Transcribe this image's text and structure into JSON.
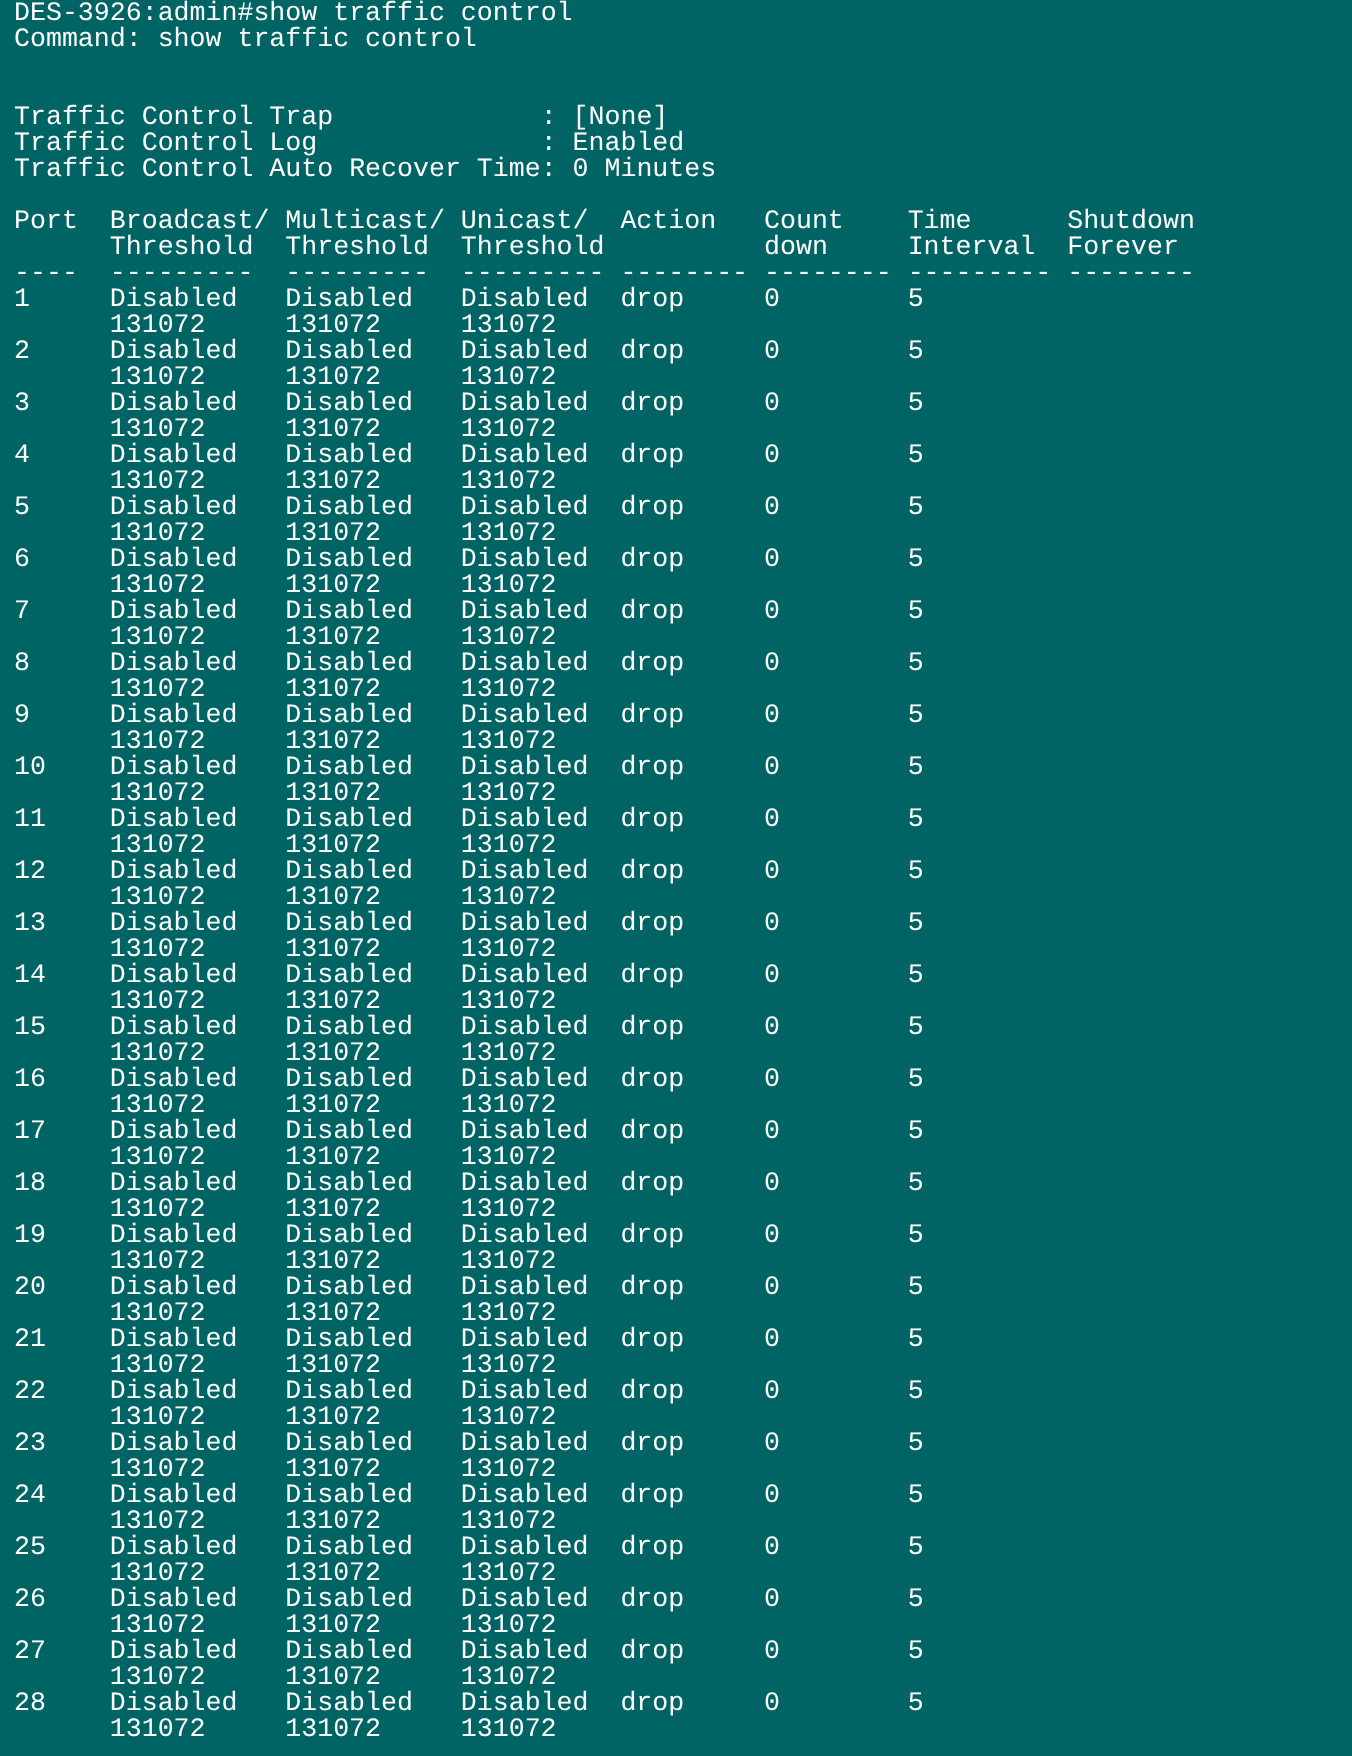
{
  "command_lines": [
    "DES-3926:admin#show traffic control",
    "Command: show traffic control"
  ],
  "settings": [
    "Traffic Control Trap             : [None]",
    "Traffic Control Log              : Enabled",
    "Traffic Control Auto Recover Time: 0 Minutes"
  ],
  "table": {
    "columns": [
      "Port",
      "Broadcast/ Threshold",
      "Multicast/ Threshold",
      "Unicast/ Threshold",
      "Action",
      "Count down",
      "Time Interval",
      "Shutdown Forever"
    ],
    "separators": [
      "----",
      "---------",
      "---------",
      "---------",
      "--------",
      "--------",
      "---------",
      "--------"
    ],
    "rows": [
      {
        "port": "1",
        "broadcast": "Disabled",
        "broadcast_threshold": "131072",
        "multicast": "Disabled",
        "multicast_threshold": "131072",
        "unicast": "Disabled",
        "unicast_threshold": "131072",
        "action": "drop",
        "countdown": "0",
        "interval": "5"
      },
      {
        "port": "2",
        "broadcast": "Disabled",
        "broadcast_threshold": "131072",
        "multicast": "Disabled",
        "multicast_threshold": "131072",
        "unicast": "Disabled",
        "unicast_threshold": "131072",
        "action": "drop",
        "countdown": "0",
        "interval": "5"
      },
      {
        "port": "3",
        "broadcast": "Disabled",
        "broadcast_threshold": "131072",
        "multicast": "Disabled",
        "multicast_threshold": "131072",
        "unicast": "Disabled",
        "unicast_threshold": "131072",
        "action": "drop",
        "countdown": "0",
        "interval": "5"
      },
      {
        "port": "4",
        "broadcast": "Disabled",
        "broadcast_threshold": "131072",
        "multicast": "Disabled",
        "multicast_threshold": "131072",
        "unicast": "Disabled",
        "unicast_threshold": "131072",
        "action": "drop",
        "countdown": "0",
        "interval": "5"
      },
      {
        "port": "5",
        "broadcast": "Disabled",
        "broadcast_threshold": "131072",
        "multicast": "Disabled",
        "multicast_threshold": "131072",
        "unicast": "Disabled",
        "unicast_threshold": "131072",
        "action": "drop",
        "countdown": "0",
        "interval": "5"
      },
      {
        "port": "6",
        "broadcast": "Disabled",
        "broadcast_threshold": "131072",
        "multicast": "Disabled",
        "multicast_threshold": "131072",
        "unicast": "Disabled",
        "unicast_threshold": "131072",
        "action": "drop",
        "countdown": "0",
        "interval": "5"
      },
      {
        "port": "7",
        "broadcast": "Disabled",
        "broadcast_threshold": "131072",
        "multicast": "Disabled",
        "multicast_threshold": "131072",
        "unicast": "Disabled",
        "unicast_threshold": "131072",
        "action": "drop",
        "countdown": "0",
        "interval": "5"
      },
      {
        "port": "8",
        "broadcast": "Disabled",
        "broadcast_threshold": "131072",
        "multicast": "Disabled",
        "multicast_threshold": "131072",
        "unicast": "Disabled",
        "unicast_threshold": "131072",
        "action": "drop",
        "countdown": "0",
        "interval": "5"
      },
      {
        "port": "9",
        "broadcast": "Disabled",
        "broadcast_threshold": "131072",
        "multicast": "Disabled",
        "multicast_threshold": "131072",
        "unicast": "Disabled",
        "unicast_threshold": "131072",
        "action": "drop",
        "countdown": "0",
        "interval": "5"
      },
      {
        "port": "10",
        "broadcast": "Disabled",
        "broadcast_threshold": "131072",
        "multicast": "Disabled",
        "multicast_threshold": "131072",
        "unicast": "Disabled",
        "unicast_threshold": "131072",
        "action": "drop",
        "countdown": "0",
        "interval": "5"
      },
      {
        "port": "11",
        "broadcast": "Disabled",
        "broadcast_threshold": "131072",
        "multicast": "Disabled",
        "multicast_threshold": "131072",
        "unicast": "Disabled",
        "unicast_threshold": "131072",
        "action": "drop",
        "countdown": "0",
        "interval": "5"
      },
      {
        "port": "12",
        "broadcast": "Disabled",
        "broadcast_threshold": "131072",
        "multicast": "Disabled",
        "multicast_threshold": "131072",
        "unicast": "Disabled",
        "unicast_threshold": "131072",
        "action": "drop",
        "countdown": "0",
        "interval": "5"
      },
      {
        "port": "13",
        "broadcast": "Disabled",
        "broadcast_threshold": "131072",
        "multicast": "Disabled",
        "multicast_threshold": "131072",
        "unicast": "Disabled",
        "unicast_threshold": "131072",
        "action": "drop",
        "countdown": "0",
        "interval": "5"
      },
      {
        "port": "14",
        "broadcast": "Disabled",
        "broadcast_threshold": "131072",
        "multicast": "Disabled",
        "multicast_threshold": "131072",
        "unicast": "Disabled",
        "unicast_threshold": "131072",
        "action": "drop",
        "countdown": "0",
        "interval": "5"
      },
      {
        "port": "15",
        "broadcast": "Disabled",
        "broadcast_threshold": "131072",
        "multicast": "Disabled",
        "multicast_threshold": "131072",
        "unicast": "Disabled",
        "unicast_threshold": "131072",
        "action": "drop",
        "countdown": "0",
        "interval": "5"
      },
      {
        "port": "16",
        "broadcast": "Disabled",
        "broadcast_threshold": "131072",
        "multicast": "Disabled",
        "multicast_threshold": "131072",
        "unicast": "Disabled",
        "unicast_threshold": "131072",
        "action": "drop",
        "countdown": "0",
        "interval": "5"
      },
      {
        "port": "17",
        "broadcast": "Disabled",
        "broadcast_threshold": "131072",
        "multicast": "Disabled",
        "multicast_threshold": "131072",
        "unicast": "Disabled",
        "unicast_threshold": "131072",
        "action": "drop",
        "countdown": "0",
        "interval": "5"
      },
      {
        "port": "18",
        "broadcast": "Disabled",
        "broadcast_threshold": "131072",
        "multicast": "Disabled",
        "multicast_threshold": "131072",
        "unicast": "Disabled",
        "unicast_threshold": "131072",
        "action": "drop",
        "countdown": "0",
        "interval": "5"
      },
      {
        "port": "19",
        "broadcast": "Disabled",
        "broadcast_threshold": "131072",
        "multicast": "Disabled",
        "multicast_threshold": "131072",
        "unicast": "Disabled",
        "unicast_threshold": "131072",
        "action": "drop",
        "countdown": "0",
        "interval": "5"
      },
      {
        "port": "20",
        "broadcast": "Disabled",
        "broadcast_threshold": "131072",
        "multicast": "Disabled",
        "multicast_threshold": "131072",
        "unicast": "Disabled",
        "unicast_threshold": "131072",
        "action": "drop",
        "countdown": "0",
        "interval": "5"
      },
      {
        "port": "21",
        "broadcast": "Disabled",
        "broadcast_threshold": "131072",
        "multicast": "Disabled",
        "multicast_threshold": "131072",
        "unicast": "Disabled",
        "unicast_threshold": "131072",
        "action": "drop",
        "countdown": "0",
        "interval": "5"
      },
      {
        "port": "22",
        "broadcast": "Disabled",
        "broadcast_threshold": "131072",
        "multicast": "Disabled",
        "multicast_threshold": "131072",
        "unicast": "Disabled",
        "unicast_threshold": "131072",
        "action": "drop",
        "countdown": "0",
        "interval": "5"
      },
      {
        "port": "23",
        "broadcast": "Disabled",
        "broadcast_threshold": "131072",
        "multicast": "Disabled",
        "multicast_threshold": "131072",
        "unicast": "Disabled",
        "unicast_threshold": "131072",
        "action": "drop",
        "countdown": "0",
        "interval": "5"
      },
      {
        "port": "24",
        "broadcast": "Disabled",
        "broadcast_threshold": "131072",
        "multicast": "Disabled",
        "multicast_threshold": "131072",
        "unicast": "Disabled",
        "unicast_threshold": "131072",
        "action": "drop",
        "countdown": "0",
        "interval": "5"
      },
      {
        "port": "25",
        "broadcast": "Disabled",
        "broadcast_threshold": "131072",
        "multicast": "Disabled",
        "multicast_threshold": "131072",
        "unicast": "Disabled",
        "unicast_threshold": "131072",
        "action": "drop",
        "countdown": "0",
        "interval": "5"
      },
      {
        "port": "26",
        "broadcast": "Disabled",
        "broadcast_threshold": "131072",
        "multicast": "Disabled",
        "multicast_threshold": "131072",
        "unicast": "Disabled",
        "unicast_threshold": "131072",
        "action": "drop",
        "countdown": "0",
        "interval": "5"
      },
      {
        "port": "27",
        "broadcast": "Disabled",
        "broadcast_threshold": "131072",
        "multicast": "Disabled",
        "multicast_threshold": "131072",
        "unicast": "Disabled",
        "unicast_threshold": "131072",
        "action": "drop",
        "countdown": "0",
        "interval": "5"
      },
      {
        "port": "28",
        "broadcast": "Disabled",
        "broadcast_threshold": "131072",
        "multicast": "Disabled",
        "multicast_threshold": "131072",
        "unicast": "Disabled",
        "unicast_threshold": "131072",
        "action": "drop",
        "countdown": "0",
        "interval": "5"
      }
    ]
  }
}
